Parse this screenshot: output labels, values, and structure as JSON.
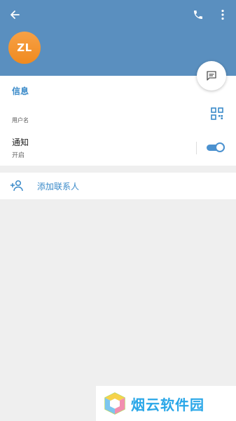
{
  "header": {
    "back_icon": "arrow-left-icon",
    "call_icon": "phone-icon",
    "more_icon": "more-vertical-icon",
    "background_color": "#5a8fbf"
  },
  "profile": {
    "avatar_initials": "ZL",
    "avatar_color": "#f5962e"
  },
  "fab": {
    "icon": "message-icon"
  },
  "info_section": {
    "title": "信息",
    "username_caption": "用户名",
    "qr_icon": "qr-code-icon"
  },
  "notifications": {
    "title": "通知",
    "status": "开启",
    "enabled": true,
    "accent_color": "#4b91cf"
  },
  "actions": {
    "add_contact_label": "添加联系人",
    "add_contact_icon": "add-person-icon"
  },
  "watermark": {
    "text": "烟云软件园"
  }
}
